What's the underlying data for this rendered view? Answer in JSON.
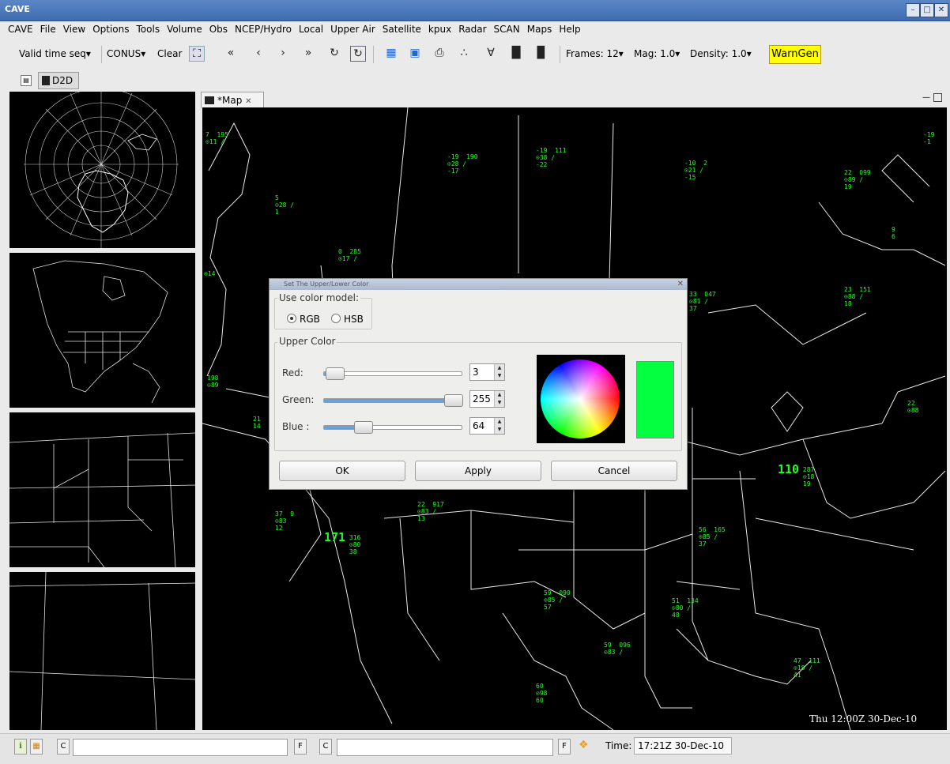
{
  "window": {
    "title": "CAVE"
  },
  "menu": [
    "CAVE",
    "File",
    "View",
    "Options",
    "Tools",
    "Volume",
    "Obs",
    "NCEP/Hydro",
    "Local",
    "Upper Air",
    "Satellite",
    "kpux",
    "Radar",
    "SCAN",
    "Maps",
    "Help"
  ],
  "toolbar": {
    "time_seq": "Valid time seq▾",
    "scale": "CONUS▾",
    "clear": "Clear",
    "frames": "Frames: 12▾",
    "mag": "Mag: 1.0▾",
    "density": "Density: 1.0▾",
    "warngen": "WarnGen"
  },
  "perspective": {
    "label": "D2D"
  },
  "editor_tab": {
    "label": "*Map",
    "close": "✕"
  },
  "map": {
    "timestamp": "Thu 12:00Z 30-Dec-10",
    "stations": [
      {
        "t": "7  195\n⊙11 ∕"
      },
      {
        "t": "-19  190\n⊙28 ∕\n-17"
      },
      {
        "t": "-19  111\n⊙38 ∕\n-22"
      },
      {
        "t": "-10  2\n⊙21 ∕\n-15"
      },
      {
        "t": "22  099\n⊙89 ∕\n19"
      },
      {
        "t": "-19\n-1"
      },
      {
        "t": "5\n⊙28 ∕\n1"
      },
      {
        "t": "0  285\n⊙17 ∕"
      },
      {
        "t": "⊙14"
      },
      {
        "t": "23  151\n⊙88 ∕\n18"
      },
      {
        "t": "33  047\n⊙81 ∕\n37"
      },
      {
        "t": "9\n6"
      },
      {
        "t": "198\n⊙89"
      },
      {
        "t": "21\n14"
      },
      {
        "t": "22\n⊙88"
      },
      {
        "t": "22  917\n⊙83 ∕\n13"
      },
      {
        "t": "37  9\n⊙83\n12"
      },
      {
        "t": "56  165\n⊙85 ∕\n37"
      },
      {
        "t": "59  090\n⊙85 ∕\n57"
      },
      {
        "t": "51  134\n⊙80 ∕\n48"
      },
      {
        "t": "59  096\n⊙83 ∕"
      },
      {
        "t": "60\n⊙98\n60"
      },
      {
        "t": "47  111\n⊙18 ∕\n41"
      }
    ],
    "big_stations": [
      {
        "v": "171",
        "t": "316\n⊙80\n38"
      },
      {
        "v": "110",
        "t": "287\n⊙18\n19"
      }
    ]
  },
  "dialog": {
    "title": "Set The Upper/Lower Color",
    "color_model_label": "Use color model:",
    "rgb": "RGB",
    "hsb": "HSB",
    "group_label": "Upper Color",
    "sliders": [
      {
        "label": "Red:",
        "value": "3",
        "fraction": 0.012
      },
      {
        "label": "Green:",
        "value": "255",
        "fraction": 1.0
      },
      {
        "label": "Blue :",
        "value": "64",
        "fraction": 0.25
      }
    ],
    "swatch_color": "#03ff40",
    "ok": "OK",
    "apply": "Apply",
    "cancel": "Cancel"
  },
  "statusbar": {
    "c1": "C",
    "c2": "C",
    "f": "F",
    "time_label": "Time:",
    "time_value": "17:21Z 30-Dec-10"
  }
}
